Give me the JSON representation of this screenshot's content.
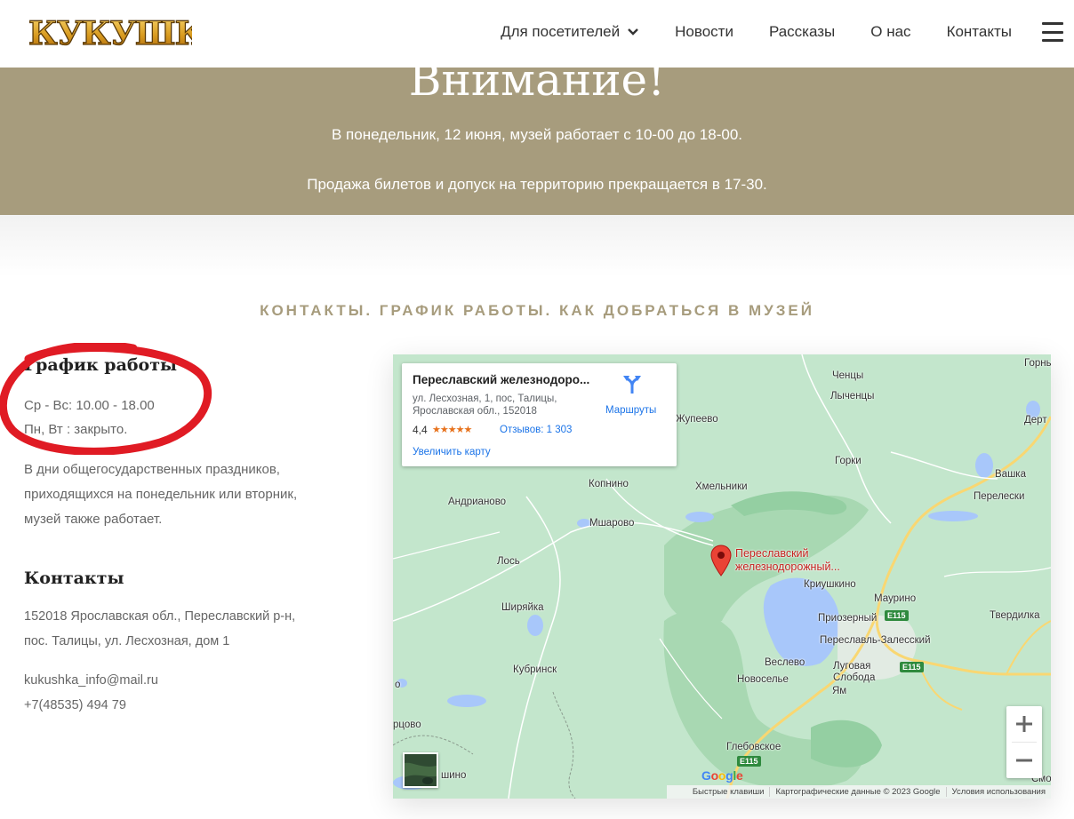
{
  "header": {
    "logo_text": "Кукушка.ру",
    "nav": [
      {
        "label": "Для посетителей"
      },
      {
        "label": "Новости"
      },
      {
        "label": "Рассказы"
      },
      {
        "label": "О нас"
      },
      {
        "label": "Контакты"
      }
    ]
  },
  "notice": {
    "title": "Внимание!",
    "line1": "В понедельник, 12 июня, музей работает с 10-00 до 18-00.",
    "line2": "Продажа билетов и допуск на территорию прекращается в 17-30."
  },
  "section_title": "КОНТАКТЫ. ГРАФИК РАБОТЫ. КАК ДОБРАТЬСЯ В МУЗЕЙ",
  "schedule": {
    "heading": "График работы",
    "open_days": "Ср - Вс: 10.00 - 18.00",
    "closed_days": "Пн, Вт : закрыто.",
    "holiday_note": "В дни общегосударственных праздников, приходящихся на понедельник или вторник, музей также работает."
  },
  "contacts": {
    "heading": "Контакты",
    "address_line1": "152018 Ярославская обл., Переславский р-н,",
    "address_line2": "пос. Талицы, ул. Лесхозная, дом 1",
    "email": "kukushka_info@mail.ru",
    "phone": "+7(48535) 494 79"
  },
  "map": {
    "card": {
      "title": "Переславский железнодоро...",
      "address": "ул. Лесхозная, 1, пос, Талицы, Ярославская обл., 152018",
      "rating": "4,4",
      "stars": "★★★★★",
      "reviews": "Отзывов: 1 303",
      "enlarge": "Увеличить карту",
      "route": "Маршруты"
    },
    "pin_label_1": "Переславский",
    "pin_label_2": "железнодорожный...",
    "places": {
      "chentsy": "Ченцы",
      "gorny": "Горны",
      "lychentsy": "Лыченцы",
      "dert": "Дерт",
      "zhupeevo": "Жупеево",
      "gorki": "Горки",
      "vashka": "Вашка",
      "kopnino": "Копнино",
      "khmelniki": "Хмельники",
      "pereleski": "Перелески",
      "andrianovo": "Андрианово",
      "msharovo": "Мшарово",
      "los": "Лось",
      "kriushkino": "Криушкино",
      "maurino": "Маурино",
      "shiryaika": "Ширяйка",
      "priozerny": "Приозерный",
      "tverdilka": "Твердилка",
      "pereslavl": "Переславль-Залесский",
      "kubrinsk": "Кубринск",
      "veslevo": "Веслево",
      "lugovaya": "Луговая",
      "sloboda": "Слобода",
      "novoselye": "Новоселье",
      "yam": "Ям",
      "o_edge": "о",
      "smo_edge": "Смо",
      "rtsovo": "рцово",
      "shino": "шино",
      "glebovskoe": "Глебовское"
    },
    "roads": {
      "e115_a": "E115",
      "e115_b": "E115",
      "e115_c": "E115"
    },
    "google": "Google",
    "footer": {
      "shortcuts": "Быстрые клавиши",
      "data": "Картографические данные © 2023 Google",
      "terms": "Условия использования"
    },
    "zoom_in": "+",
    "zoom_out": "−"
  }
}
